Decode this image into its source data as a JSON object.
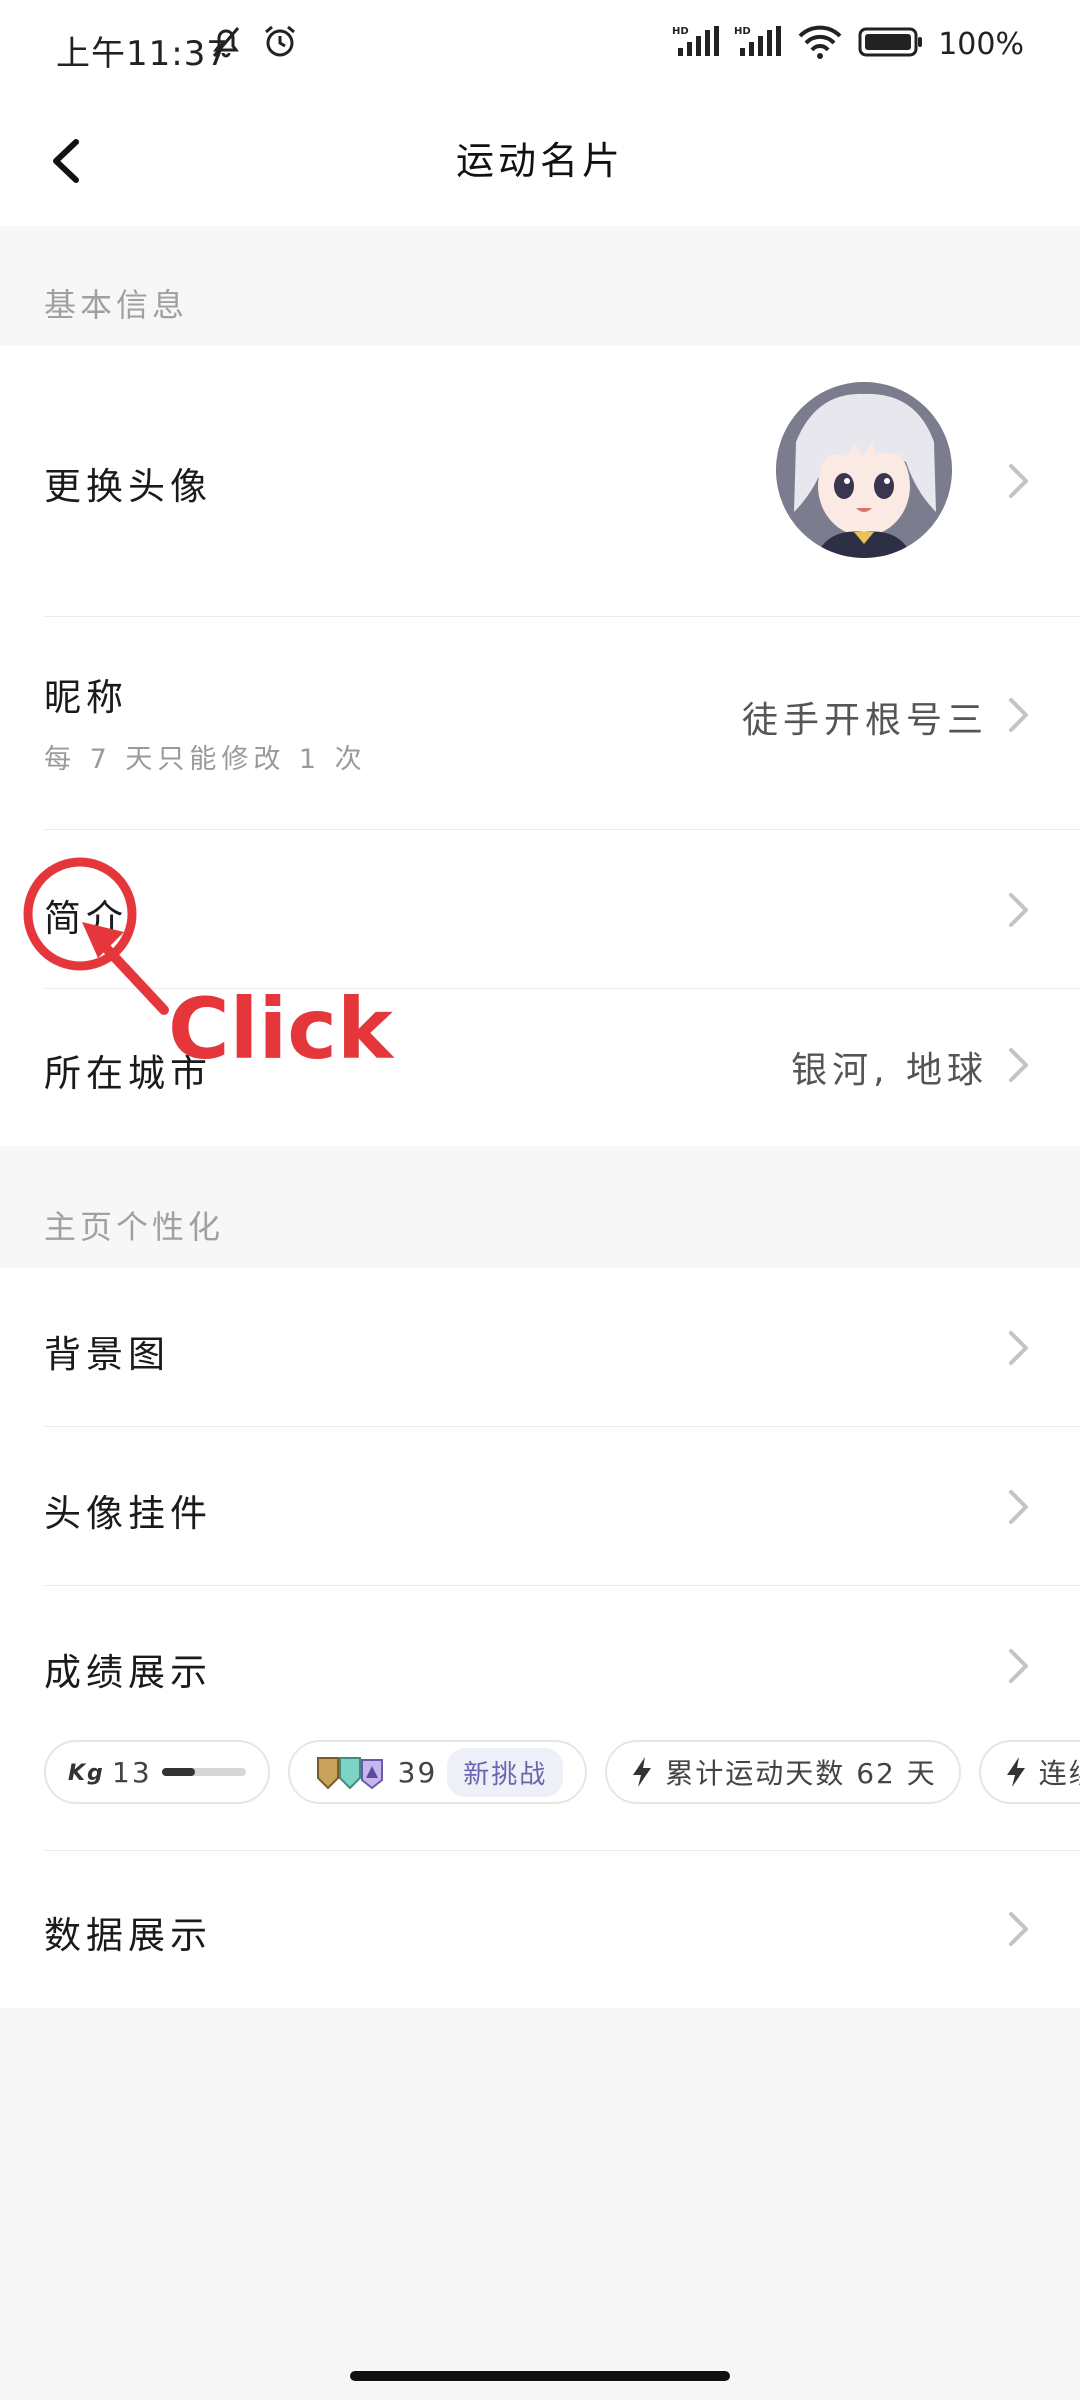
{
  "status_bar": {
    "time": "上午11:37",
    "battery": "100%",
    "icons": [
      "mute-bell-icon",
      "alarm-icon",
      "signal-hd-icon",
      "signal-hd-icon",
      "wifi-icon",
      "battery-icon"
    ]
  },
  "nav": {
    "title": "运动名片",
    "back_icon": "chevron-left-icon"
  },
  "sections": {
    "basic": {
      "header": "基本信息"
    },
    "personalize": {
      "header": "主页个性化"
    }
  },
  "rows": {
    "avatar": {
      "label": "更换头像"
    },
    "nickname": {
      "label": "昵称",
      "sub": "每 7 天只能修改 1 次",
      "value": "徒手开根号三"
    },
    "bio": {
      "label": "简介"
    },
    "city": {
      "label": "所在城市",
      "value": "银河, 地球"
    },
    "background": {
      "label": "背景图"
    },
    "pendant": {
      "label": "头像挂件"
    },
    "achievements": {
      "label": "成绩展示"
    },
    "data": {
      "label": "数据展示"
    }
  },
  "chips": {
    "kg": {
      "icon": "kg-icon",
      "value": "13",
      "progress": 0.4
    },
    "challenge": {
      "icon": "badges-icon",
      "value": "39",
      "tag": "新挑战"
    },
    "total_days": {
      "icon": "lightning-icon",
      "label": "累计运动天数 62 天"
    },
    "streak": {
      "icon": "lightning-icon",
      "label": "连续运动"
    }
  },
  "annotation": {
    "label": "Click",
    "color": "#e5373b"
  }
}
